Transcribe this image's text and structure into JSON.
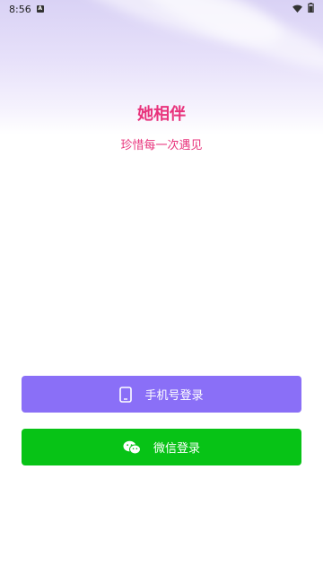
{
  "status_bar": {
    "time": "8:56",
    "notification_icon": "a-icon",
    "wifi_icon": "wifi-icon",
    "battery_icon": "battery-icon"
  },
  "header": {
    "app_name": "她相伴",
    "slogan": "珍惜每一次遇见"
  },
  "login": {
    "phone_label": "手机号登录",
    "phone_icon": "phone-icon",
    "wechat_label": "微信登录",
    "wechat_icon": "wechat-icon"
  },
  "colors": {
    "brand": "#e8337c",
    "phone_button": "#8a6ff7",
    "wechat_button": "#07c316",
    "hero_bg": "#e3ddf8"
  }
}
